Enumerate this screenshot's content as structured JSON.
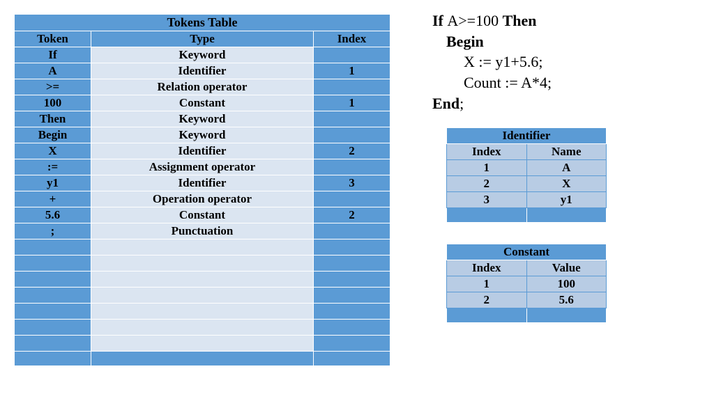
{
  "tokens_table": {
    "title": "Tokens Table",
    "headers": [
      "Token",
      "Type",
      "Index"
    ],
    "rows": [
      {
        "token": "If",
        "type": "Keyword",
        "index": ""
      },
      {
        "token": "A",
        "type": "Identifier",
        "index": "1"
      },
      {
        "token": ">=",
        "type": "Relation operator",
        "index": ""
      },
      {
        "token": "100",
        "type": "Constant",
        "index": "1"
      },
      {
        "token": "Then",
        "type": "Keyword",
        "index": ""
      },
      {
        "token": "Begin",
        "type": "Keyword",
        "index": ""
      },
      {
        "token": "X",
        "type": "Identifier",
        "index": "2"
      },
      {
        "token": ":=",
        "type": "Assignment operator",
        "index": ""
      },
      {
        "token": "y1",
        "type": "Identifier",
        "index": "3"
      },
      {
        "token": "+",
        "type": "Operation operator",
        "index": ""
      },
      {
        "token": "5.6",
        "type": "Constant",
        "index": "2"
      },
      {
        "token": ";",
        "type": "Punctuation",
        "index": ""
      }
    ],
    "empty_rows": 7
  },
  "code": {
    "l1_b1": "If ",
    "l1_n": "A>=100 ",
    "l1_b2": "Then",
    "l2": "Begin",
    "l3": "X := y1+5.6;",
    "l4": "Count := A*4;",
    "l5_b": "End",
    "l5_n": ";"
  },
  "identifier_table": {
    "title": "Identifier",
    "headers": [
      "Index",
      "Name"
    ],
    "rows": [
      {
        "index": "1",
        "name": "A"
      },
      {
        "index": "2",
        "name": "X"
      },
      {
        "index": "3",
        "name": "y1"
      }
    ]
  },
  "constant_table": {
    "title": "Constant",
    "headers": [
      "Index",
      "Value"
    ],
    "rows": [
      {
        "index": "1",
        "value": "100"
      },
      {
        "index": "2",
        "value": "5.6"
      }
    ]
  }
}
